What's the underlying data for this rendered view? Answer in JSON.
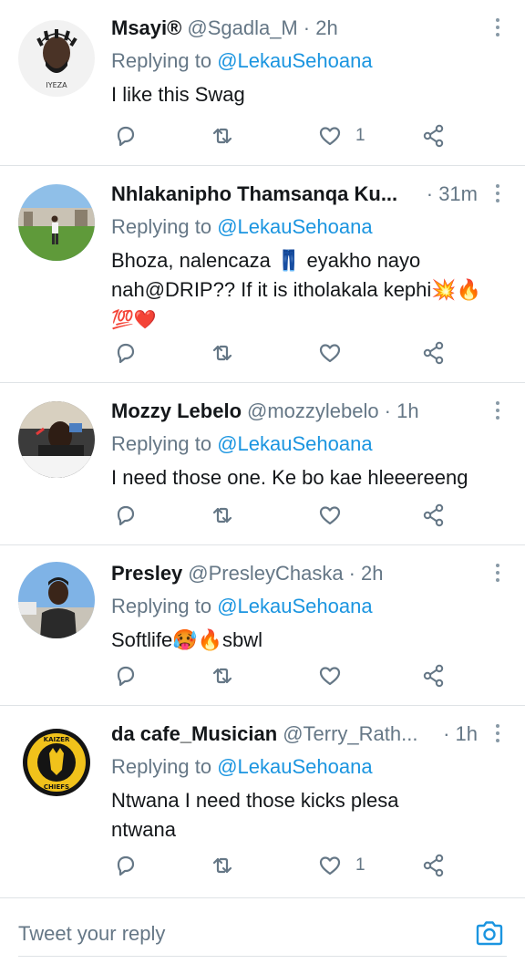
{
  "colors": {
    "link": "#1b95e0",
    "muted": "#657786",
    "text": "#14171a",
    "divider": "#dfe3e6"
  },
  "tweets": [
    {
      "name": "Msayi®",
      "handle": "@Sgadla_M",
      "time": "· 2h",
      "replying_prefix": "Replying to ",
      "replying_to": "@LekauSehoana",
      "text_lines": [
        "I like this Swag"
      ],
      "likes": "1",
      "avatar_text": "IYEZA"
    },
    {
      "name": "Nhlakanipho Thamsanqa Ku...",
      "handle": "",
      "time": "· 31m",
      "replying_prefix": "Replying to ",
      "replying_to": "@LekauSehoana",
      "text_lines": [
        "Bhoza, nalencaza 👖 eyakho nayo",
        "nah@DRIP?? If it is itholakala kephi💥🔥",
        "💯❤️"
      ],
      "likes": ""
    },
    {
      "name": "Mozzy Lebelo",
      "handle": "@mozzylebelo",
      "time": "· 1h",
      "replying_prefix": "Replying to ",
      "replying_to": "@LekauSehoana",
      "text_lines": [
        "I need those one. Ke bo kae hleeereeng"
      ],
      "likes": ""
    },
    {
      "name": "Presley",
      "handle": "@PresleyChaska",
      "time": "· 2h",
      "replying_prefix": "Replying to ",
      "replying_to": "@LekauSehoana",
      "text_lines": [
        "Softlife🥵🔥sbwl"
      ],
      "likes": ""
    },
    {
      "name": "da cafe_Musician",
      "handle": "@Terry_Rath...",
      "time": "· 1h",
      "replying_prefix": "Replying to ",
      "replying_to": "@LekauSehoana",
      "text_lines": [
        "Ntwana I need those kicks  plesa",
        "ntwana"
      ],
      "likes": "1",
      "avatar_text_top": "KAIZER",
      "avatar_text_bottom": "CHIEFS"
    }
  ],
  "compose": {
    "placeholder": "Tweet your reply"
  },
  "icons": {
    "reply": "reply-icon",
    "retweet": "retweet-icon",
    "like": "heart-icon",
    "share": "share-icon",
    "more": "more-vertical-icon",
    "camera": "camera-icon"
  }
}
